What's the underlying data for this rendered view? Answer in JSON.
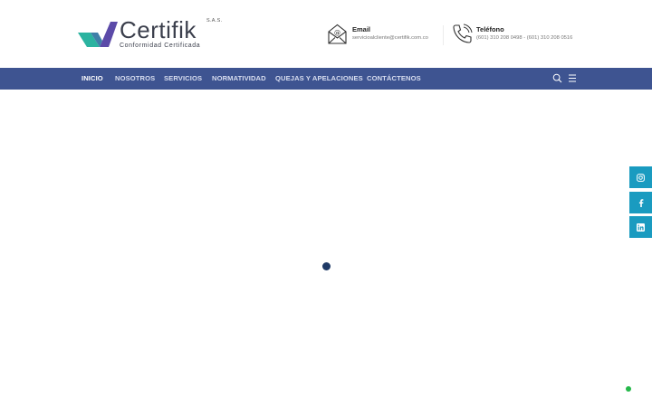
{
  "brand": {
    "name": "Certifik",
    "suffix": "S.A.S.",
    "tagline": "Conformidad Certificada",
    "colors": {
      "primary": "#5b4aa8",
      "accent": "#2bb3a0",
      "text": "#3b3f4c"
    }
  },
  "contacts": {
    "email": {
      "label": "Email",
      "value": "servicioalcliente@certifik.com.co",
      "icon": "envelope-at-icon"
    },
    "phone": {
      "label": "Teléfono",
      "value": "(601) 310 208 0498 - (601) 310 208 0516",
      "icon": "phone-icon"
    }
  },
  "nav": {
    "background": "#3e5491",
    "items": [
      {
        "label": "INICIO",
        "active": true
      },
      {
        "label": "NOSOTROS"
      },
      {
        "label": "SERVICIOS"
      },
      {
        "label": "NORMATIVIDAD"
      },
      {
        "label": "QUEJAS Y APELACIONES"
      },
      {
        "label": "CONTÁCTENOS"
      }
    ],
    "icons": [
      "search-icon",
      "menu-icon"
    ]
  },
  "social": {
    "color": "#1a9bc0",
    "items": [
      "instagram-icon",
      "facebook-icon",
      "linkedin-icon"
    ]
  },
  "loader": {
    "color": "#1f3a66"
  },
  "chat": {
    "color": "#25b84a",
    "icon": "whatsapp-icon"
  }
}
